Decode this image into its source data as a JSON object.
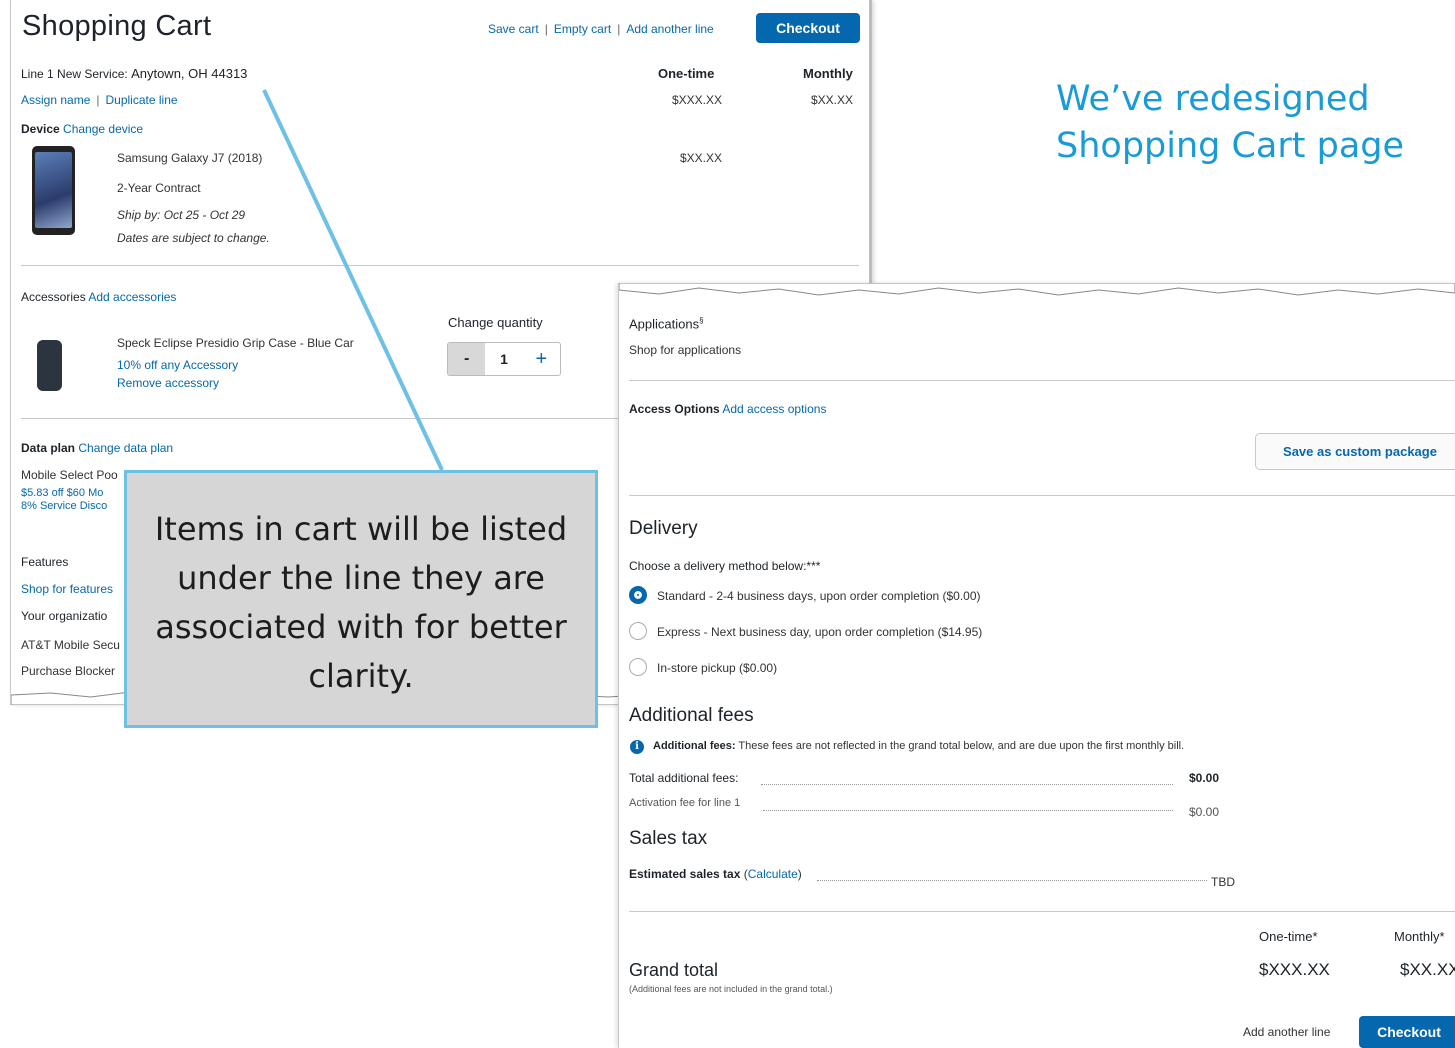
{
  "headline": {
    "line1": "We’ve redesigned",
    "line2": "Shopping Cart page"
  },
  "callout": {
    "text": "Items in cart will be listed under the line they are associated with for better clarity."
  },
  "cart": {
    "title": "Shopping Cart",
    "top_links": {
      "save_cart": "Save cart",
      "empty_cart": "Empty cart",
      "add_line": "Add another line",
      "sep": "|"
    },
    "checkout_label": "Checkout",
    "line": {
      "label": "Line 1 New Service:",
      "location": "Anytown, OH 44313",
      "assign_name": "Assign name",
      "duplicate_line": "Duplicate line"
    },
    "col_onetime": "One-time",
    "col_monthly": "Monthly",
    "line_onetime": "$XXX.XX",
    "line_monthly": "$XX.XX",
    "device": {
      "label": "Device",
      "change": "Change device",
      "name": "Samsung Galaxy J7 (2018)",
      "contract": "2-Year Contract",
      "ship": "Ship by: Oct 25 - Oct 29",
      "note": "Dates are subject to change.",
      "price": "$XX.XX"
    },
    "accessories": {
      "label": "Accessories",
      "add": "Add accessories",
      "change_qty": "Change quantity",
      "name": "Speck Eclipse Presidio Grip Case - Blue Car",
      "promo": "10% off any Accessory",
      "remove": "Remove accessory",
      "qty_minus": "-",
      "qty": "1",
      "qty_plus": "+"
    },
    "data_plan": {
      "label": "Data plan",
      "change": "Change data plan",
      "name": "Mobile Select Poo",
      "promo1": "$5.83 off $60 Mo",
      "promo2": "8% Service Disco"
    },
    "features": {
      "label": "Features",
      "shop": "Shop for features",
      "org": "Your organizatio",
      "item1": "AT&T Mobile Secu",
      "item2": "Purchase Blocker"
    }
  },
  "checkout": {
    "applications": {
      "label": "Applications",
      "sup": "§",
      "shop": "Shop for applications"
    },
    "access": {
      "label": "Access Options",
      "add": "Add access options",
      "save_package": "Save as custom package"
    },
    "delivery": {
      "title": "Delivery",
      "prompt": "Choose a delivery method below:***",
      "options": [
        "Standard - 2-4 business days, upon order completion ($0.00)",
        "Express - Next business day, upon order completion ($14.95)",
        "In-store pickup ($0.00)"
      ]
    },
    "fees": {
      "title": "Additional fees",
      "info_icon": "i",
      "note_label": "Additional fees:",
      "note": "These fees are not reflected in the grand total below, and are due upon the first monthly bill.",
      "total_label": "Total additional fees:",
      "total_value": "$0.00",
      "activation_label": "Activation fee for line 1",
      "activation_value": "$0.00"
    },
    "tax": {
      "title": "Sales tax",
      "label": "Estimated sales tax",
      "paren_open": "(",
      "calc": "Calculate",
      "paren_close": ")",
      "value": "TBD"
    },
    "grand": {
      "title": "Grand total",
      "note": "(Additional fees are not included in the grand total.)",
      "col_onetime": "One-time*",
      "col_monthly": "Monthly*",
      "onetime": "$XXX.XX",
      "monthly": "$XX.XX"
    },
    "add_line": "Add another line",
    "checkout_label": "Checkout"
  },
  "colors": {
    "accent": "#0568ae",
    "headline": "#1a9bd7",
    "callout_border": "#6ec1e4"
  }
}
